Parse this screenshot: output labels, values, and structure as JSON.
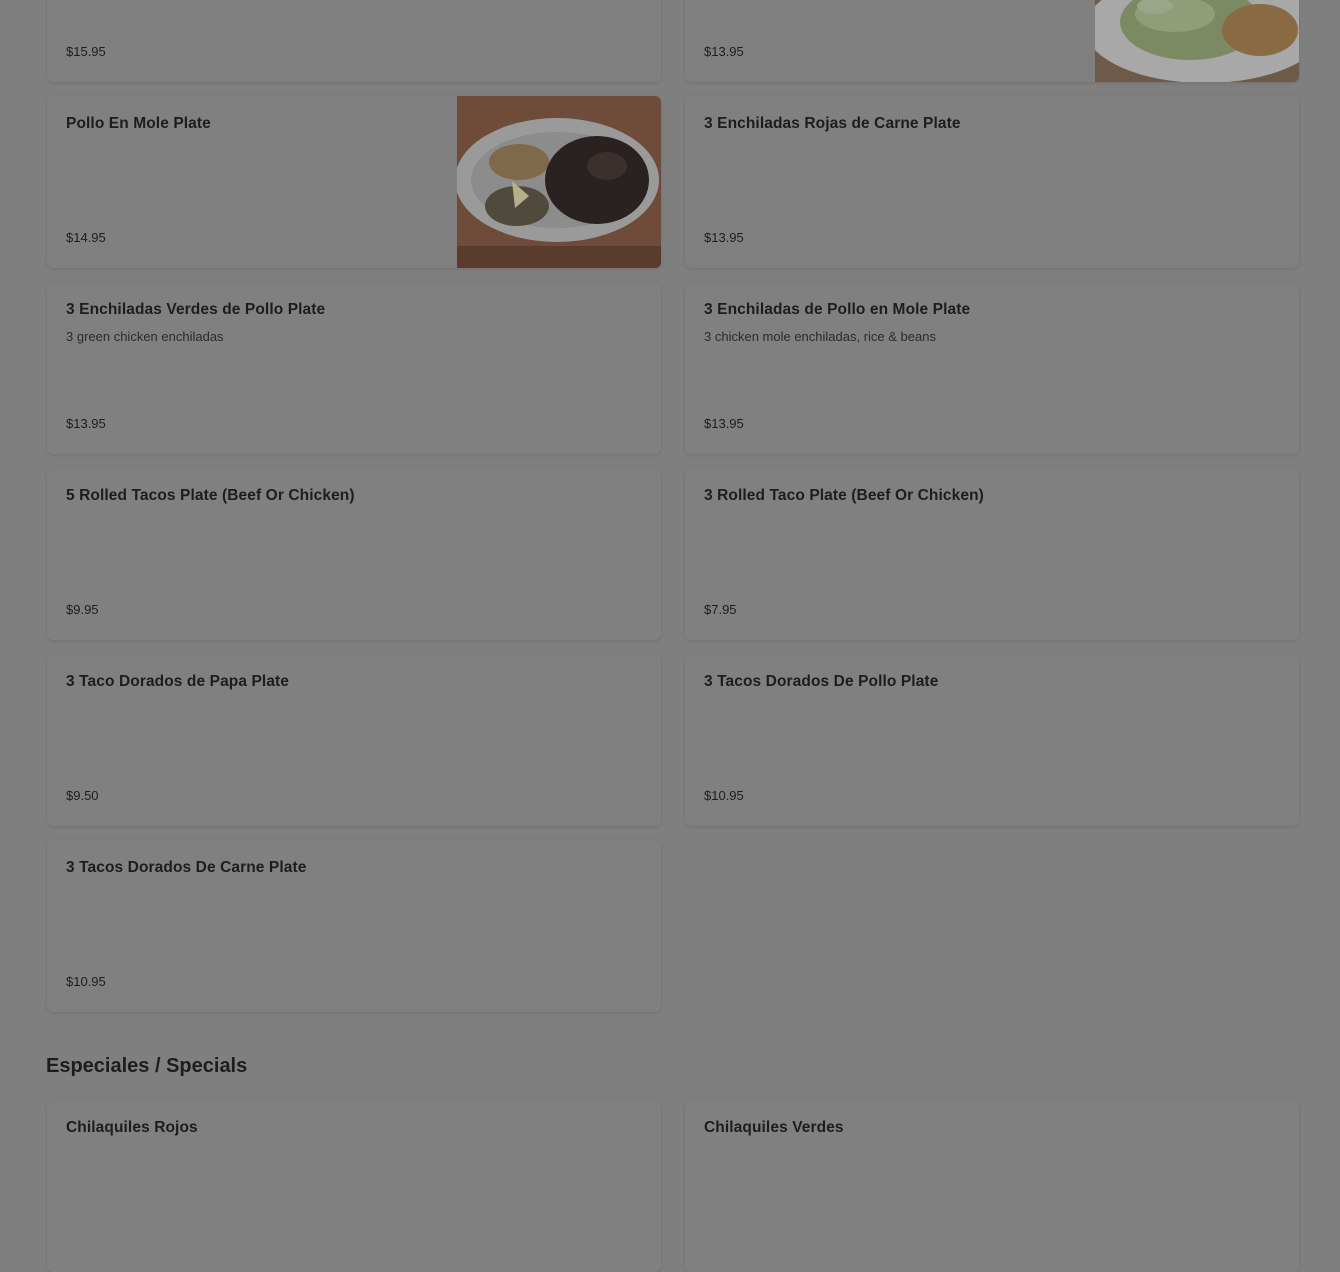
{
  "menu_items": [
    {
      "title": "",
      "price": "$15.95"
    },
    {
      "title": "",
      "price": "$13.95"
    },
    {
      "title": "Pollo En Mole Plate",
      "price": "$14.95"
    },
    {
      "title": "3 Enchiladas Rojas de Carne Plate",
      "price": "$13.95"
    },
    {
      "title": "3 Enchiladas Verdes de Pollo Plate",
      "description": "3 green chicken enchiladas",
      "price": "$13.95"
    },
    {
      "title": "3 Enchiladas de Pollo en Mole Plate",
      "description": "3 chicken mole enchiladas, rice & beans",
      "price": "$13.95"
    },
    {
      "title": "5 Rolled Tacos Plate (Beef Or Chicken)",
      "price": "$9.95"
    },
    {
      "title": "3 Rolled Taco Plate (Beef Or Chicken)",
      "price": "$7.95"
    },
    {
      "title": "3 Taco Dorados de Papa Plate",
      "price": "$9.50"
    },
    {
      "title": "3 Tacos Dorados De Pollo Plate",
      "price": "$10.95"
    },
    {
      "title": "3 Tacos Dorados De Carne Plate",
      "price": "$10.95"
    }
  ],
  "specials_section": {
    "title": "Especiales / Specials",
    "items": [
      {
        "title": "Chilaquiles Rojos"
      },
      {
        "title": "Chilaquiles Verdes"
      }
    ]
  }
}
